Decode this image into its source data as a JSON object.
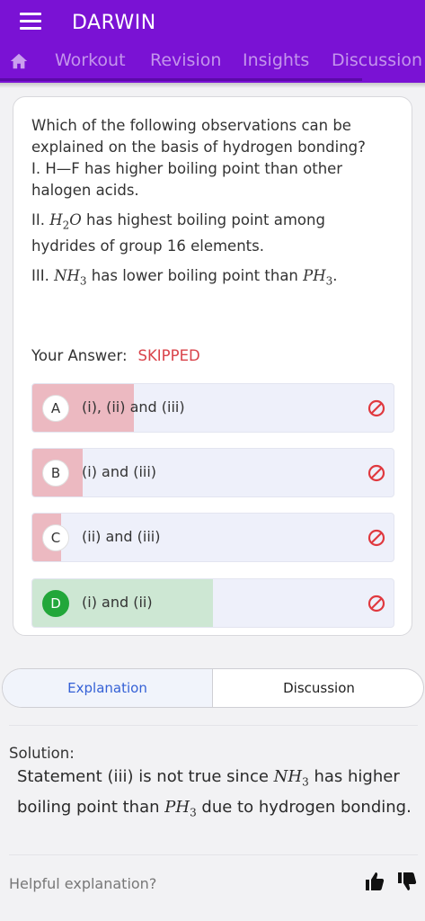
{
  "header": {
    "title": "DARWIN",
    "tabs": [
      "Workout",
      "Revision",
      "Insights",
      "Discussion"
    ]
  },
  "question": {
    "text": "Which of the following observations can be explained on the basis of hydrogen bonding?",
    "statement1": "I. H—F has higher boiling point than other halogen acids.",
    "statement2_prefix": "II.",
    "statement2_math": "H",
    "statement2_sub": "2",
    "statement2_math2": "O",
    "statement2_rest": " has highest boiling point among hydrides of group 16 elements.",
    "statement3_prefix": "III.",
    "statement3_math1": "NH",
    "statement3_sub1": "3",
    "statement3_mid": " has lower boiling point than ",
    "statement3_math2": "PH",
    "statement3_sub2": "3",
    "statement3_end": "."
  },
  "answer": {
    "label": "Your Answer:",
    "value": "SKIPPED"
  },
  "options": [
    {
      "letter": "A",
      "text": "(i), (ii) and (iii)",
      "percent": 28,
      "correct": false
    },
    {
      "letter": "B",
      "text": "(i) and (iii)",
      "percent": 14,
      "correct": false
    },
    {
      "letter": "C",
      "text": "(ii) and (iii)",
      "percent": 8,
      "correct": false
    },
    {
      "letter": "D",
      "text": "(i) and (ii)",
      "percent": 50,
      "correct": true
    }
  ],
  "bottom_tabs": {
    "explanation": "Explanation",
    "discussion": "Discussion"
  },
  "solution": {
    "label": "Solution:",
    "part1": "Statement (iii) is not true since ",
    "math1": "NH",
    "sub1": "3",
    "part2": " has higher boiling point than ",
    "math2": "PH",
    "sub2": "3",
    "part3": " due to hydrogen bonding."
  },
  "feedback": {
    "label": "Helpful explanation?"
  },
  "colors": {
    "brand": "#7a12d4",
    "wrong_fill": "#ecb9c1",
    "correct_fill": "#cde7d3",
    "ban": "#e0393f"
  }
}
